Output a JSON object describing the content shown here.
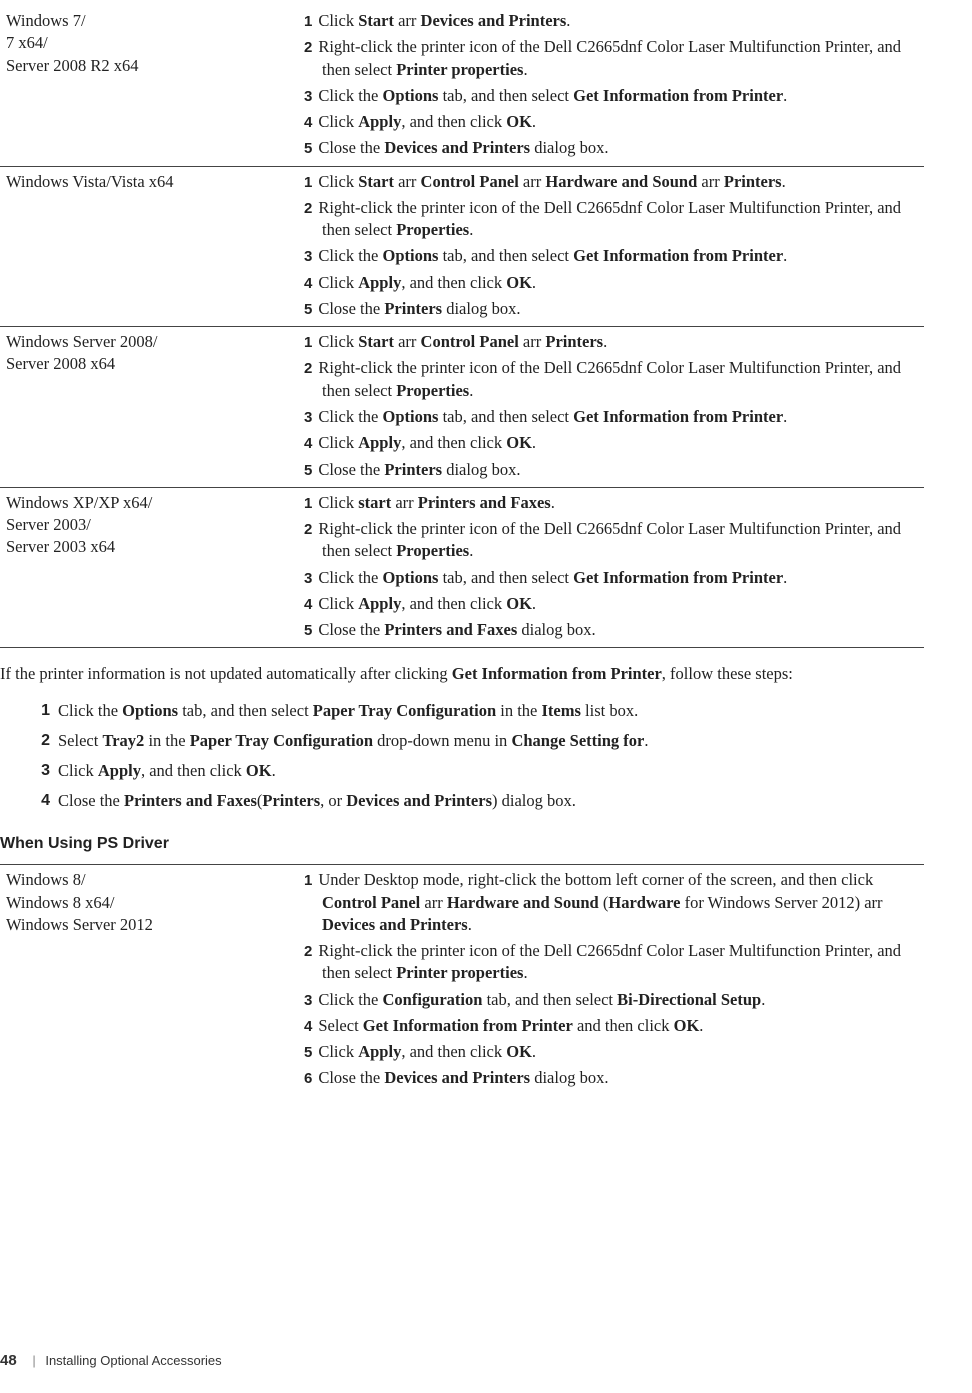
{
  "arrow": "→",
  "t1": {
    "rows": [
      {
        "os": [
          "Windows 7/",
          "7 x64/",
          "Server 2008 R2 x64"
        ],
        "steps": [
          [
            [
              "Click "
            ],
            [
              "b",
              "Start"
            ],
            [
              " "
            ],
            [
              "arr"
            ],
            [
              " "
            ],
            [
              "b",
              "Devices and Printers"
            ],
            [
              "."
            ]
          ],
          [
            [
              "Right-click the printer icon of the Dell C2665dnf Color Laser Multifunction Printer, and then select "
            ],
            [
              "b",
              "Printer properties"
            ],
            [
              "."
            ]
          ],
          [
            [
              "Click the "
            ],
            [
              "b",
              "Options"
            ],
            [
              " tab, and then select "
            ],
            [
              "b",
              "Get Information from Printer"
            ],
            [
              "."
            ]
          ],
          [
            [
              "Click "
            ],
            [
              "b",
              "Apply"
            ],
            [
              ", and then click "
            ],
            [
              "b",
              "OK"
            ],
            [
              "."
            ]
          ],
          [
            [
              "Close the "
            ],
            [
              "b",
              "Devices and Printers"
            ],
            [
              " dialog box."
            ]
          ]
        ]
      },
      {
        "os": [
          "Windows Vista/Vista x64"
        ],
        "steps": [
          [
            [
              "Click "
            ],
            [
              "b",
              "Start"
            ],
            [
              " "
            ],
            [
              "arr"
            ],
            [
              " "
            ],
            [
              "b",
              "Control Panel"
            ],
            [
              " "
            ],
            [
              "arr"
            ],
            [
              " "
            ],
            [
              "b",
              "Hardware and Sound"
            ],
            [
              " "
            ],
            [
              "arr"
            ],
            [
              " "
            ],
            [
              "b",
              "Printers"
            ],
            [
              "."
            ]
          ],
          [
            [
              "Right-click the printer icon of the Dell C2665dnf Color Laser Multifunction Printer, and then select "
            ],
            [
              "b",
              "Properties"
            ],
            [
              "."
            ]
          ],
          [
            [
              "Click the "
            ],
            [
              "b",
              "Options"
            ],
            [
              " tab, and then select "
            ],
            [
              "b",
              "Get Information from Printer"
            ],
            [
              "."
            ]
          ],
          [
            [
              "Click "
            ],
            [
              "b",
              "Apply"
            ],
            [
              ", and then click "
            ],
            [
              "b",
              "OK"
            ],
            [
              "."
            ]
          ],
          [
            [
              "Close the "
            ],
            [
              "b",
              "Printers"
            ],
            [
              " dialog box."
            ]
          ]
        ]
      },
      {
        "os": [
          "Windows Server 2008/",
          "Server 2008 x64"
        ],
        "steps": [
          [
            [
              "Click "
            ],
            [
              "b",
              "Start"
            ],
            [
              " "
            ],
            [
              "arr"
            ],
            [
              " "
            ],
            [
              "b",
              "Control Panel"
            ],
            [
              " "
            ],
            [
              "arr"
            ],
            [
              " "
            ],
            [
              "b",
              "Printers"
            ],
            [
              "."
            ]
          ],
          [
            [
              "Right-click the printer icon of the Dell C2665dnf Color Laser Multifunction Printer, and then select "
            ],
            [
              "b",
              "Properties"
            ],
            [
              "."
            ]
          ],
          [
            [
              "Click the "
            ],
            [
              "b",
              "Options"
            ],
            [
              " tab, and then select "
            ],
            [
              "b",
              "Get Information from Printer"
            ],
            [
              "."
            ]
          ],
          [
            [
              "Click "
            ],
            [
              "b",
              "Apply"
            ],
            [
              ", and then click "
            ],
            [
              "b",
              "OK"
            ],
            [
              "."
            ]
          ],
          [
            [
              "Close the "
            ],
            [
              "b",
              "Printers"
            ],
            [
              " dialog box."
            ]
          ]
        ]
      },
      {
        "os": [
          "Windows XP/XP x64/",
          "Server 2003/",
          "Server 2003 x64"
        ],
        "steps": [
          [
            [
              "Click "
            ],
            [
              "b",
              "start"
            ],
            [
              " "
            ],
            [
              "arr"
            ],
            [
              " "
            ],
            [
              "b",
              "Printers and Faxes"
            ],
            [
              "."
            ]
          ],
          [
            [
              "Right-click the printer icon of the Dell C2665dnf Color Laser Multifunction Printer, and then select "
            ],
            [
              "b",
              "Properties"
            ],
            [
              "."
            ]
          ],
          [
            [
              "Click the "
            ],
            [
              "b",
              "Options"
            ],
            [
              " tab, and then select "
            ],
            [
              "b",
              "Get Information from Printer"
            ],
            [
              "."
            ]
          ],
          [
            [
              "Click "
            ],
            [
              "b",
              "Apply"
            ],
            [
              ", and then click "
            ],
            [
              "b",
              "OK"
            ],
            [
              "."
            ]
          ],
          [
            [
              "Close the "
            ],
            [
              "b",
              "Printers and Faxes"
            ],
            [
              " dialog box."
            ]
          ]
        ]
      }
    ]
  },
  "para_intro": [
    [
      "If the printer information is not updated automatically after clicking "
    ],
    [
      "b",
      "Get Information from Printer"
    ],
    [
      ", follow these steps:"
    ]
  ],
  "biglist": [
    [
      [
        "Click the "
      ],
      [
        "b",
        "Options"
      ],
      [
        " tab, and then select "
      ],
      [
        "b",
        "Paper Tray Configuration"
      ],
      [
        " in the "
      ],
      [
        "b",
        "Items"
      ],
      [
        " list box."
      ]
    ],
    [
      [
        "Select "
      ],
      [
        "b",
        "Tray2"
      ],
      [
        " in the "
      ],
      [
        "b",
        "Paper Tray Configuration"
      ],
      [
        " drop-down menu in "
      ],
      [
        "b",
        "Change Setting for"
      ],
      [
        "."
      ]
    ],
    [
      [
        "Click "
      ],
      [
        "b",
        "Apply"
      ],
      [
        ", and then click "
      ],
      [
        "b",
        "OK"
      ],
      [
        "."
      ]
    ],
    [
      [
        "Close the "
      ],
      [
        "b",
        "Printers and Faxes"
      ],
      [
        "("
      ],
      [
        "b",
        "Printers"
      ],
      [
        ", or "
      ],
      [
        "b",
        "Devices and Printers"
      ],
      [
        ") dialog box."
      ]
    ]
  ],
  "section2": "When Using PS Driver",
  "t2": {
    "rows": [
      {
        "os": [
          "Windows 8/",
          "Windows 8 x64/",
          "Windows Server 2012"
        ],
        "steps": [
          [
            [
              "Under Desktop mode, right-click the bottom left corner of the screen, and then click "
            ],
            [
              "b",
              "Control Panel"
            ],
            [
              " "
            ],
            [
              "arr"
            ],
            [
              " "
            ],
            [
              "b",
              "Hardware and Sound"
            ],
            [
              " ("
            ],
            [
              "b",
              "Hardware"
            ],
            [
              " for Windows Server 2012) "
            ],
            [
              "arr"
            ],
            [
              " "
            ],
            [
              "b",
              "Devices and Printers"
            ],
            [
              "."
            ]
          ],
          [
            [
              "Right-click the printer icon of the Dell C2665dnf Color Laser Multifunction Printer, and then select "
            ],
            [
              "b",
              "Printer properties"
            ],
            [
              "."
            ]
          ],
          [
            [
              "Click the "
            ],
            [
              "b",
              "Configuration"
            ],
            [
              " tab, and then select "
            ],
            [
              "b",
              "Bi-Directional Setup"
            ],
            [
              "."
            ]
          ],
          [
            [
              "Select "
            ],
            [
              "b",
              "Get Information from Printer"
            ],
            [
              " and then click "
            ],
            [
              "b",
              "OK"
            ],
            [
              "."
            ]
          ],
          [
            [
              "Click "
            ],
            [
              "b",
              "Apply"
            ],
            [
              ", and then click "
            ],
            [
              "b",
              "OK"
            ],
            [
              "."
            ]
          ],
          [
            [
              "Close the "
            ],
            [
              "b",
              "Devices and Printers"
            ],
            [
              " dialog box."
            ]
          ]
        ]
      }
    ]
  },
  "footer": {
    "page": "48",
    "chapter": "Installing Optional Accessories"
  }
}
